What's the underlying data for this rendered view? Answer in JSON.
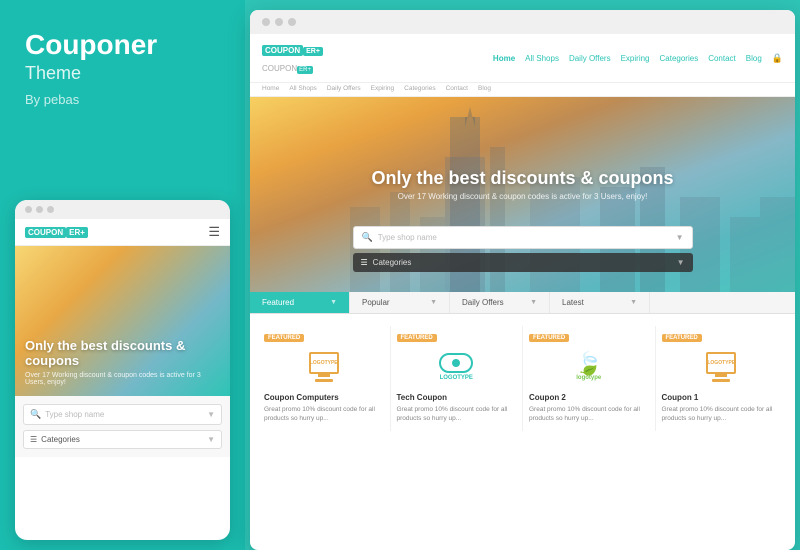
{
  "left": {
    "title": "Couponer",
    "subtitle": "Theme",
    "author": "By pebas"
  },
  "mobile": {
    "dots": [
      "dot1",
      "dot2",
      "dot3"
    ],
    "logo_text": "COUPON",
    "logo_badge": "ER+",
    "hero_text": "Only the best discounts & coupons",
    "hero_sub": "Over 17 Working discount & coupon codes is active for 3 Users, enjoy!",
    "search_placeholder": "Type shop name",
    "categories_label": "Categories"
  },
  "desktop": {
    "dots": [
      "dot1",
      "dot2",
      "dot3"
    ],
    "logo_text": "COUPON",
    "logo_badge": "ER+",
    "logo_text2": "COUPON",
    "logo_badge2": "ER+",
    "nav_links": [
      "Home",
      "All Shops",
      "Daily Offers",
      "Expiring",
      "Categories",
      "Contact",
      "Blog"
    ],
    "nav_sub_links": [
      "Home",
      "All Shops",
      "Daily Offers",
      "Expiring",
      "Categories",
      "Contact",
      "Blog"
    ],
    "hero_title": "Only the best discounts & coupons",
    "hero_sub": "Over 17 Working discount & coupon codes is active for 3 Users, enjoy!",
    "search_placeholder": "Type shop name",
    "categories_label": "Categories",
    "tabs": [
      "Featured",
      "Popular",
      "Daily Offers",
      "Latest"
    ],
    "cards": [
      {
        "badge": "FEATURED",
        "logo_type": "monitor",
        "logo_color": "#e8a845",
        "title": "Coupon Computers",
        "desc": "Great promo 10% discount code for all products so hurry up..."
      },
      {
        "badge": "FEATURED",
        "logo_type": "eye",
        "logo_color": "#2ec4b6",
        "title": "Tech Coupon",
        "desc": "Great promo 10% discount code for all products so hurry up..."
      },
      {
        "badge": "FEATURED",
        "logo_type": "leaf",
        "logo_color": "#7dc855",
        "title": "Coupon 2",
        "desc": "Great promo 10% discount code for all products so hurry up..."
      },
      {
        "badge": "FEATURED",
        "logo_type": "monitor",
        "logo_color": "#e8a845",
        "title": "Coupon 1",
        "desc": "Great promo 10% discount code for all products so hurry up..."
      }
    ]
  }
}
